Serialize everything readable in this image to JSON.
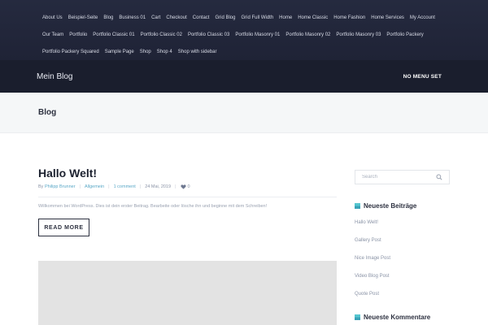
{
  "topnav": {
    "row1": [
      "About Us",
      "Beispiel-Seite",
      "Blog",
      "Business 01",
      "Cart",
      "Checkout",
      "Contact",
      "Grid Blog",
      "Grid Full Width",
      "Home",
      "Home Classic",
      "Home Fashion",
      "Home Services",
      "My Account"
    ],
    "row2": [
      "Our Team",
      "Portfolio",
      "Portfolio Classic 01",
      "Portfolio Classic 02",
      "Portfolio Classic 03",
      "Portfolio Masonry 01",
      "Portfolio Masonry 02",
      "Portfolio Masonry 03",
      "Portfolio Packery"
    ],
    "row3": [
      "Portfolio Packery Squared",
      "Sample Page",
      "Shop",
      "Shop 4",
      "Shop with sidebar"
    ]
  },
  "header": {
    "site_title": "Mein Blog",
    "menu_label": "NO MENU SET"
  },
  "page": {
    "title": "Blog"
  },
  "post": {
    "title": "Hallo Welt!",
    "author_prefix": "By",
    "author": "Philipp Brunner",
    "category": "Allgemein",
    "comments": "1 comment",
    "date": "24 Mai, 2019",
    "likes": "0",
    "excerpt": "Willkommen bei WordPress. Dies ist dein erster Beitrag. Bearbeite oder lösche ihn und beginne mit dem Schreiben!",
    "read_more": "READ MORE"
  },
  "sidebar": {
    "search_placeholder": "Search",
    "recent_posts_title": "Neueste Beiträge",
    "recent_posts": [
      "Hallo Welt!",
      "Gallery Post",
      "Nice Image Post",
      "Video Blog Post",
      "Quote Post"
    ],
    "recent_comments_title": "Neueste Kommentare"
  },
  "colors": {
    "nav_bg": "#252a3f",
    "header_bg": "#1a1e2d",
    "accent": "#55c6cf",
    "link": "#5aa8c7"
  }
}
